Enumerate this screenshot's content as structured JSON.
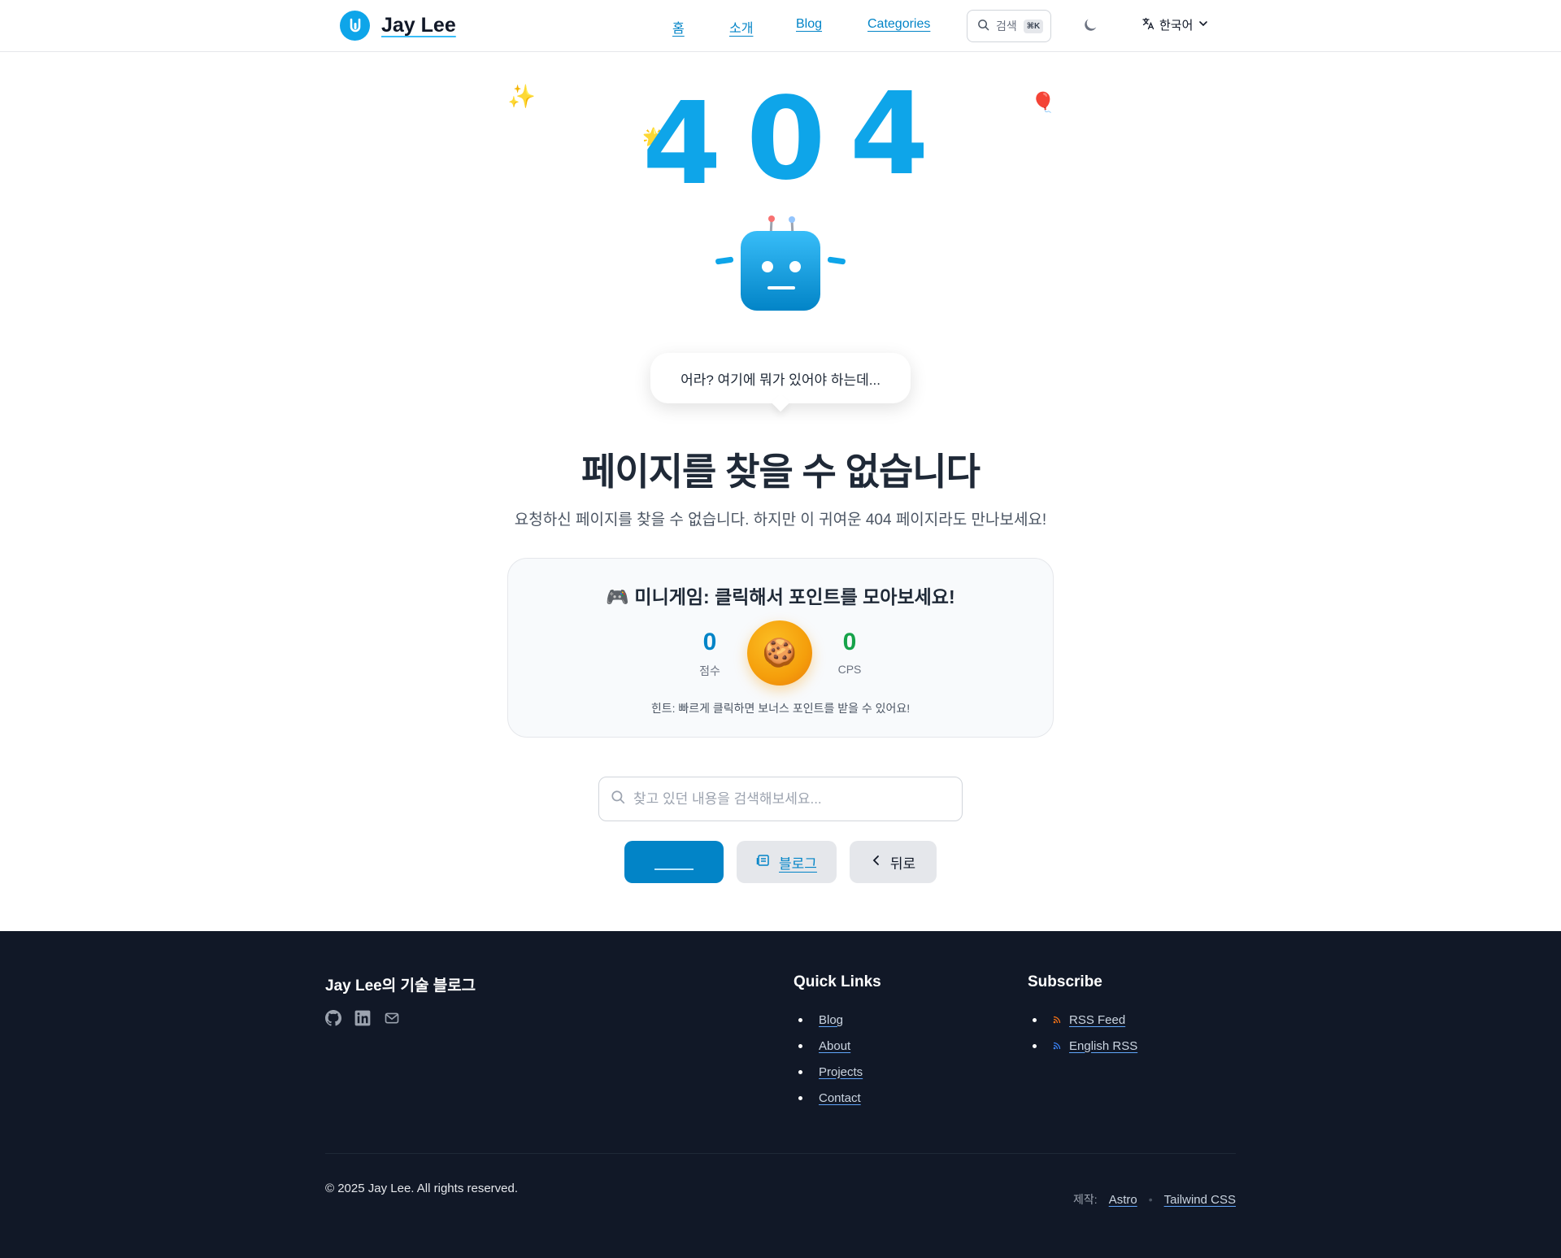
{
  "header": {
    "brand": "Jay Lee",
    "nav": [
      "홈",
      "소개",
      "Blog",
      "Categories"
    ],
    "search_label": "검색",
    "search_shortcut": "⌘K",
    "language": "한국어"
  },
  "hero": {
    "digits": [
      "4",
      "0",
      "4"
    ],
    "bubble_text": "어라? 여기에 뭐가 있어야 하는데...",
    "title": "페이지를 찾을 수 없습니다",
    "subtitle": "요청하신 페이지를 찾을 수 없습니다. 하지만 이 귀여운 404 페이지라도 만나보세요!"
  },
  "game": {
    "title": "🎮 미니게임: 클릭해서 포인트를 모아보세요!",
    "score_value": "0",
    "score_label": "점수",
    "cps_value": "0",
    "cps_label": "CPS",
    "cookie": "🍪",
    "hint": "힌트: 빠르게 클릭하면 보너스 포인트를 받을 수 있어요!"
  },
  "search": {
    "placeholder": "찾고 있던 내용을 검색해보세요..."
  },
  "buttons": {
    "blog": "블로그",
    "back": "뒤로"
  },
  "footer": {
    "blog_title": "Jay Lee의 기술 블로그",
    "social_icons": [
      "github-icon",
      "linkedin-icon",
      "mail-icon"
    ],
    "quick_links_title": "Quick Links",
    "quick_links": [
      "Blog",
      "About",
      "Projects",
      "Contact"
    ],
    "subscribe_title": "Subscribe",
    "subscribe_links": [
      "RSS Feed",
      "English RSS"
    ],
    "copyright": "© 2025 Jay Lee. All rights reserved.",
    "made_with_label": "제작:",
    "made_with": [
      "Astro",
      "Tailwind CSS"
    ]
  },
  "colors": {
    "accent": "#0ea5e9",
    "primary_button": "#0284c7",
    "footer_bg": "#111827",
    "cps_green": "#16a34a"
  }
}
